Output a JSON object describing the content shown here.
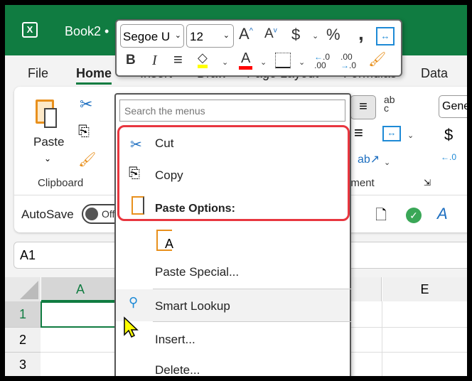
{
  "titlebar": {
    "app_icon": "excel-icon",
    "doc_title": "Book2 •"
  },
  "tabs": [
    "File",
    "Home",
    "Insert",
    "Draw",
    "Page Layout",
    "Formulas",
    "Data"
  ],
  "active_tab": "Home",
  "ribbon": {
    "paste_label": "Paste",
    "clipboard_group": "Clipboard",
    "alignment_group": "Alignment",
    "number_format": "General",
    "wrap_icon_text": "ab c"
  },
  "qat": {
    "autosave_label": "AutoSave",
    "autosave_state": "Off"
  },
  "namebox": {
    "value": "A1"
  },
  "grid": {
    "columns": [
      "A",
      "E"
    ],
    "rows": [
      "1",
      "2",
      "3"
    ]
  },
  "mini_toolbar": {
    "font": "Segoe U",
    "size": "12",
    "grow": "A",
    "shrink": "A",
    "currency": "$",
    "percent": "%",
    "comma": ",",
    "bold": "B",
    "italic": "I",
    "font_color_letter": "A",
    "inc_decimal": ".00",
    "dec_decimal": ".0",
    "fill_color": "#ffff00",
    "font_color": "#ff0000"
  },
  "context_menu": {
    "search_placeholder": "Search the menus",
    "cut": "Cut",
    "copy": "Copy",
    "paste_options": "Paste Options:",
    "paste_special": "Paste Special...",
    "smart_lookup": "Smart Lookup",
    "insert": "Insert...",
    "delete": "Delete...",
    "highlight_color": "#e8363f"
  }
}
